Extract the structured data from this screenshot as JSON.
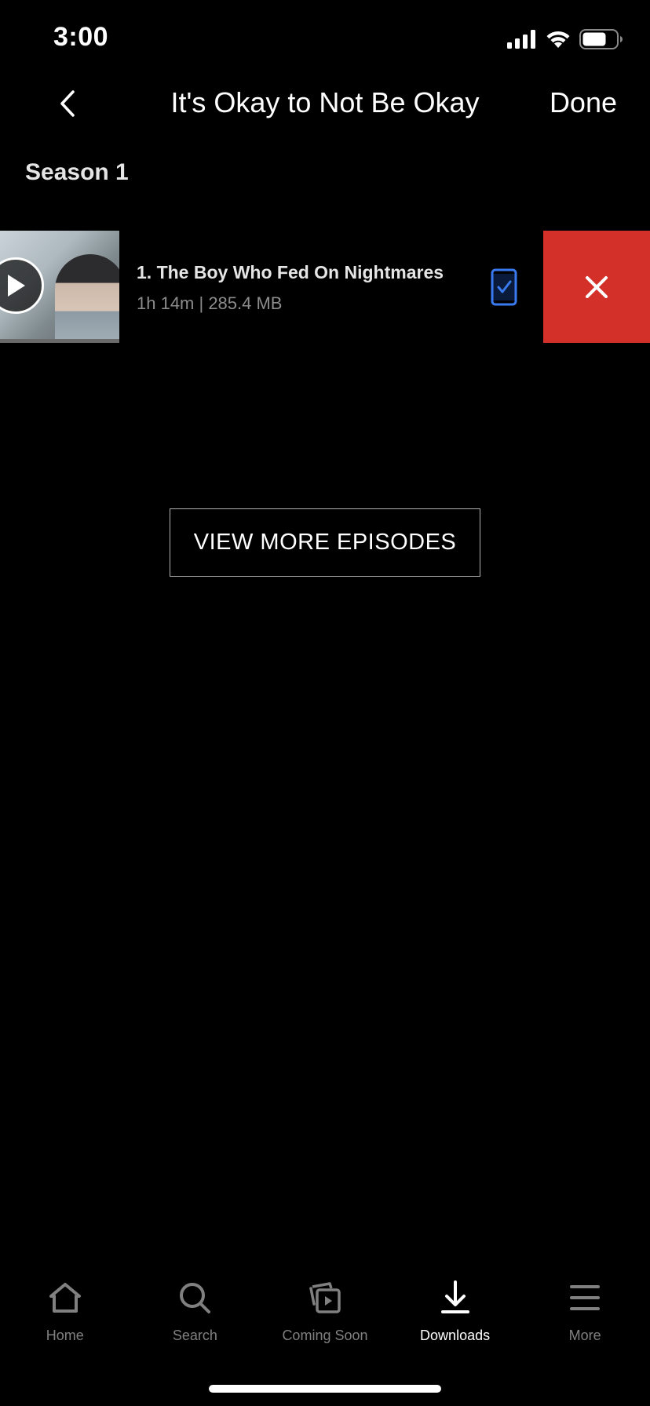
{
  "status_bar": {
    "time": "3:00",
    "icons": [
      "signal-icon",
      "wifi-icon",
      "battery-icon"
    ]
  },
  "header": {
    "title": "It's Okay to Not Be Okay",
    "done_label": "Done",
    "back_icon": "chevron-left-icon"
  },
  "season": {
    "label": "Season 1"
  },
  "episode": {
    "title": "1. The Boy Who Fed On Nightmares",
    "meta": "1h 14m | 285.4 MB",
    "status_icon": "downloaded-device-icon",
    "delete_icon": "close-icon"
  },
  "view_more": {
    "label": "VIEW MORE EPISODES"
  },
  "tabs": [
    {
      "label": "Home",
      "icon": "home-icon",
      "active": false
    },
    {
      "label": "Search",
      "icon": "search-icon",
      "active": false
    },
    {
      "label": "Coming Soon",
      "icon": "coming-soon-icon",
      "active": false
    },
    {
      "label": "Downloads",
      "icon": "download-icon",
      "active": true
    },
    {
      "label": "More",
      "icon": "menu-icon",
      "active": false
    }
  ],
  "colors": {
    "background": "#000000",
    "delete_red": "#d3302a",
    "accent_blue": "#3a7af0",
    "muted_text": "#808080"
  }
}
